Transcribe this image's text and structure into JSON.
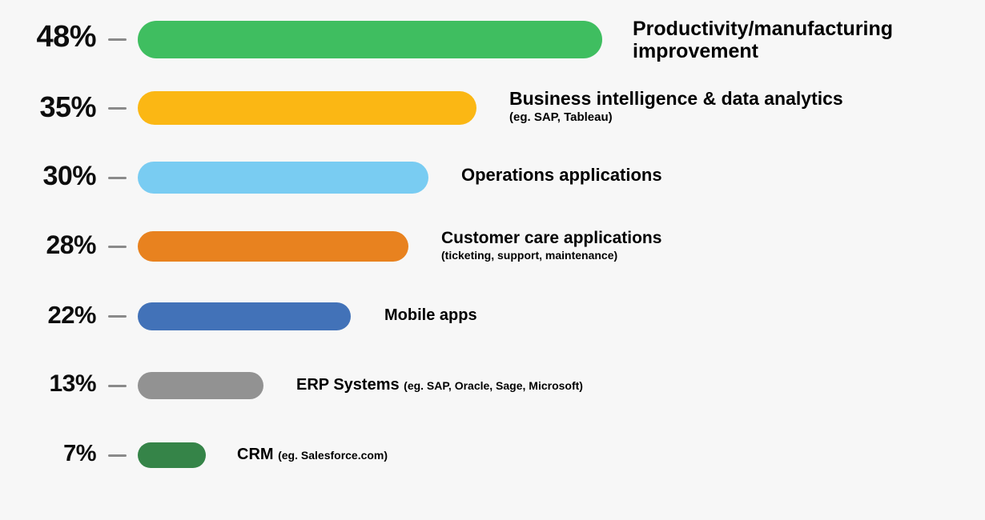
{
  "chart_data": {
    "type": "bar",
    "orientation": "horizontal",
    "title": "",
    "subtitle": "",
    "xlabel": "",
    "ylabel": "",
    "xlim": [
      0,
      48
    ],
    "grid": false,
    "legend": false,
    "value_suffix": "%",
    "background_color": "#f7f7f7",
    "categories": [
      "Productivity/manufacturing improvement",
      "Business intelligence & data analytics",
      "Operations applications",
      "Customer care applications",
      "Mobile apps",
      "ERP Systems",
      "CRM"
    ],
    "values": [
      48,
      35,
      30,
      28,
      22,
      13,
      7
    ],
    "value_labels": [
      "48%",
      "35%",
      "30%",
      "28%",
      "22%",
      "13%",
      "7%"
    ],
    "colors": [
      "#3fbe60",
      "#fbb714",
      "#79ccf2",
      "#e8821f",
      "#4272b8",
      "#929292",
      "#358448"
    ],
    "annotations": [
      "(eg. SAP, Tableau)",
      "(ticketing, support, maintenance)",
      "(eg. SAP, Oracle, Sage, Microsoft)",
      "(eg. Salesforce.com)"
    ]
  },
  "rows": [
    {
      "percent": "48%",
      "label": "Productivity/manufacturing",
      "label_line2": "improvement",
      "sub": "",
      "color": "#3fbe60",
      "value": 48
    },
    {
      "percent": "35%",
      "label": "Business intelligence & data analytics",
      "label_line2": "",
      "sub": "(eg. SAP, Tableau)",
      "color": "#fbb714",
      "value": 35
    },
    {
      "percent": "30%",
      "label": "Operations applications",
      "label_line2": "",
      "sub": "",
      "color": "#79ccf2",
      "value": 30
    },
    {
      "percent": "28%",
      "label": "Customer care applications",
      "label_line2": "",
      "sub": "(ticketing, support, maintenance)",
      "color": "#e8821f",
      "value": 28
    },
    {
      "percent": "22%",
      "label": "Mobile apps",
      "label_line2": "",
      "sub": "",
      "color": "#4272b8",
      "value": 22
    },
    {
      "percent": "13%",
      "label": "ERP Systems",
      "label_line2": "",
      "sub": "(eg. SAP, Oracle, Sage, Microsoft)",
      "color": "#929292",
      "value": 13
    },
    {
      "percent": "7%",
      "label": "CRM",
      "label_line2": "",
      "sub": "(eg. Salesforce.com)",
      "color": "#358448",
      "value": 7
    }
  ]
}
